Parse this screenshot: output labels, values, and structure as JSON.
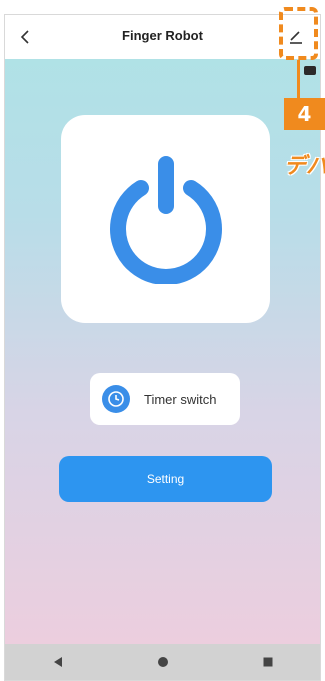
{
  "app_bar": {
    "title": "Finger Robot",
    "back_icon": "chevron-left-icon",
    "edit_icon": "edit-icon"
  },
  "power": {
    "icon": "power-icon",
    "color": "#3a8ee8"
  },
  "timer": {
    "label": "Timer switch",
    "icon": "clock-icon",
    "color": "#3a8ee8"
  },
  "setting": {
    "label": "Setting",
    "color": "#2d95f0"
  },
  "nav": [
    "back-triangle-icon",
    "home-circle-icon",
    "recents-square-icon"
  ],
  "annotation": {
    "number": "4",
    "text": "デバ",
    "color": "#f08a1e"
  }
}
